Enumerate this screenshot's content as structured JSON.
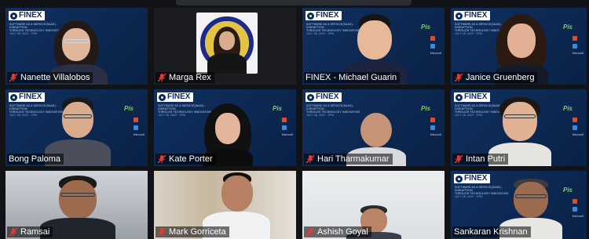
{
  "window": {
    "title": ""
  },
  "branding": {
    "logo_text": "FINEX",
    "subtitle_line1": "SOFTWARE AS A SERVICE(SAAS) - DISRUPTION",
    "subtitle_line2": "THROUGH TECHNOLOGY INNOVATION",
    "subtitle_line3": "JULY 28, 2022 · 2PM",
    "sponsor_logo": "Pis",
    "partner_label": "Microsoft",
    "colors": {
      "background": "#0c2750",
      "logo_bg": "#ffffff",
      "sponsor": "#7fd06a"
    }
  },
  "participants": [
    {
      "name": "Nanette Villalobos",
      "muted": true,
      "background": "branded"
    },
    {
      "name": "Marga Rex",
      "muted": true,
      "background": "dark",
      "avatar": "portrait-card"
    },
    {
      "name": "FINEX - Michael Guarin",
      "muted": false,
      "background": "branded"
    },
    {
      "name": "Janice Gruenberg",
      "muted": true,
      "background": "branded"
    },
    {
      "name": "Bong Paloma",
      "muted": false,
      "background": "branded"
    },
    {
      "name": "Kate Porter",
      "muted": true,
      "background": "branded"
    },
    {
      "name": "Hari Tharmakumar",
      "muted": true,
      "background": "branded"
    },
    {
      "name": "Intan Putri",
      "muted": true,
      "background": "branded"
    },
    {
      "name": "Ramsai",
      "muted": true,
      "background": "room"
    },
    {
      "name": "Mark Gorriceta",
      "muted": true,
      "background": "room"
    },
    {
      "name": "Ashish Goyal",
      "muted": true,
      "background": "room"
    },
    {
      "name": "Sankaran Krishnan",
      "muted": false,
      "background": "branded"
    }
  ],
  "icons": {
    "muted": "mic-off-icon"
  }
}
